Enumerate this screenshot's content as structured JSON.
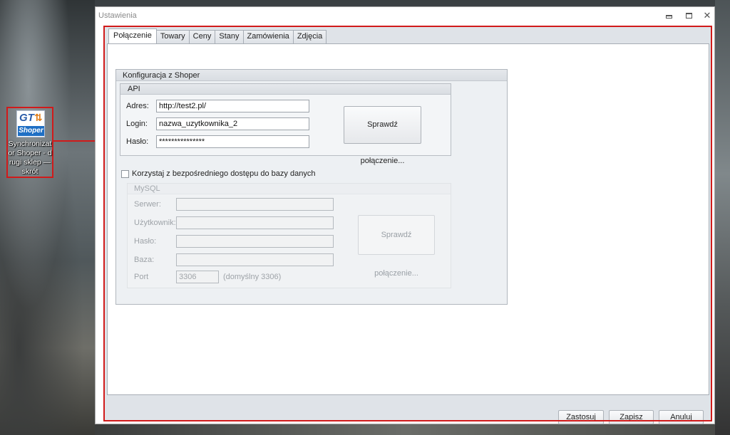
{
  "window": {
    "title": "Ustawienia"
  },
  "shortcut": {
    "label": "Synchronizator Shoper - drugi sklep — skrót",
    "icon_text_top": "GT",
    "icon_text_bottom": "Shoper"
  },
  "tabs": [
    {
      "label": "Połączenie",
      "active": true
    },
    {
      "label": "Towary",
      "active": false
    },
    {
      "label": "Ceny",
      "active": false
    },
    {
      "label": "Stany",
      "active": false
    },
    {
      "label": "Zamówienia",
      "active": false
    },
    {
      "label": "Zdjęcia",
      "active": false
    }
  ],
  "shoper_group": {
    "title": "Konfiguracja z Shoper",
    "api": {
      "title": "API",
      "address_label": "Adres:",
      "address_value": "http://test2.pl/",
      "login_label": "Login:",
      "login_value": "nazwa_uzytkownika_2",
      "password_label": "Hasło:",
      "password_value": "***************",
      "test_button": "Sprawdź połączenie..."
    },
    "direct_db_checkbox": {
      "label": "Korzystaj z bezpośredniego dostępu do bazy danych",
      "checked": false
    },
    "mysql": {
      "title": "MySQL",
      "server_label": "Serwer:",
      "user_label": "Użytkownik:",
      "password_label": "Hasło:",
      "database_label": "Baza:",
      "port_label": "Port",
      "port_value": "3306",
      "port_hint": "(domyślny 3306)",
      "test_button": "Sprawdź połączenie..."
    }
  },
  "footer": {
    "apply": "Zastosuj",
    "save": "Zapisz",
    "cancel": "Anuluj"
  },
  "colors": {
    "highlight": "#d11a1a",
    "panel_bg": "#dfe3e8"
  }
}
